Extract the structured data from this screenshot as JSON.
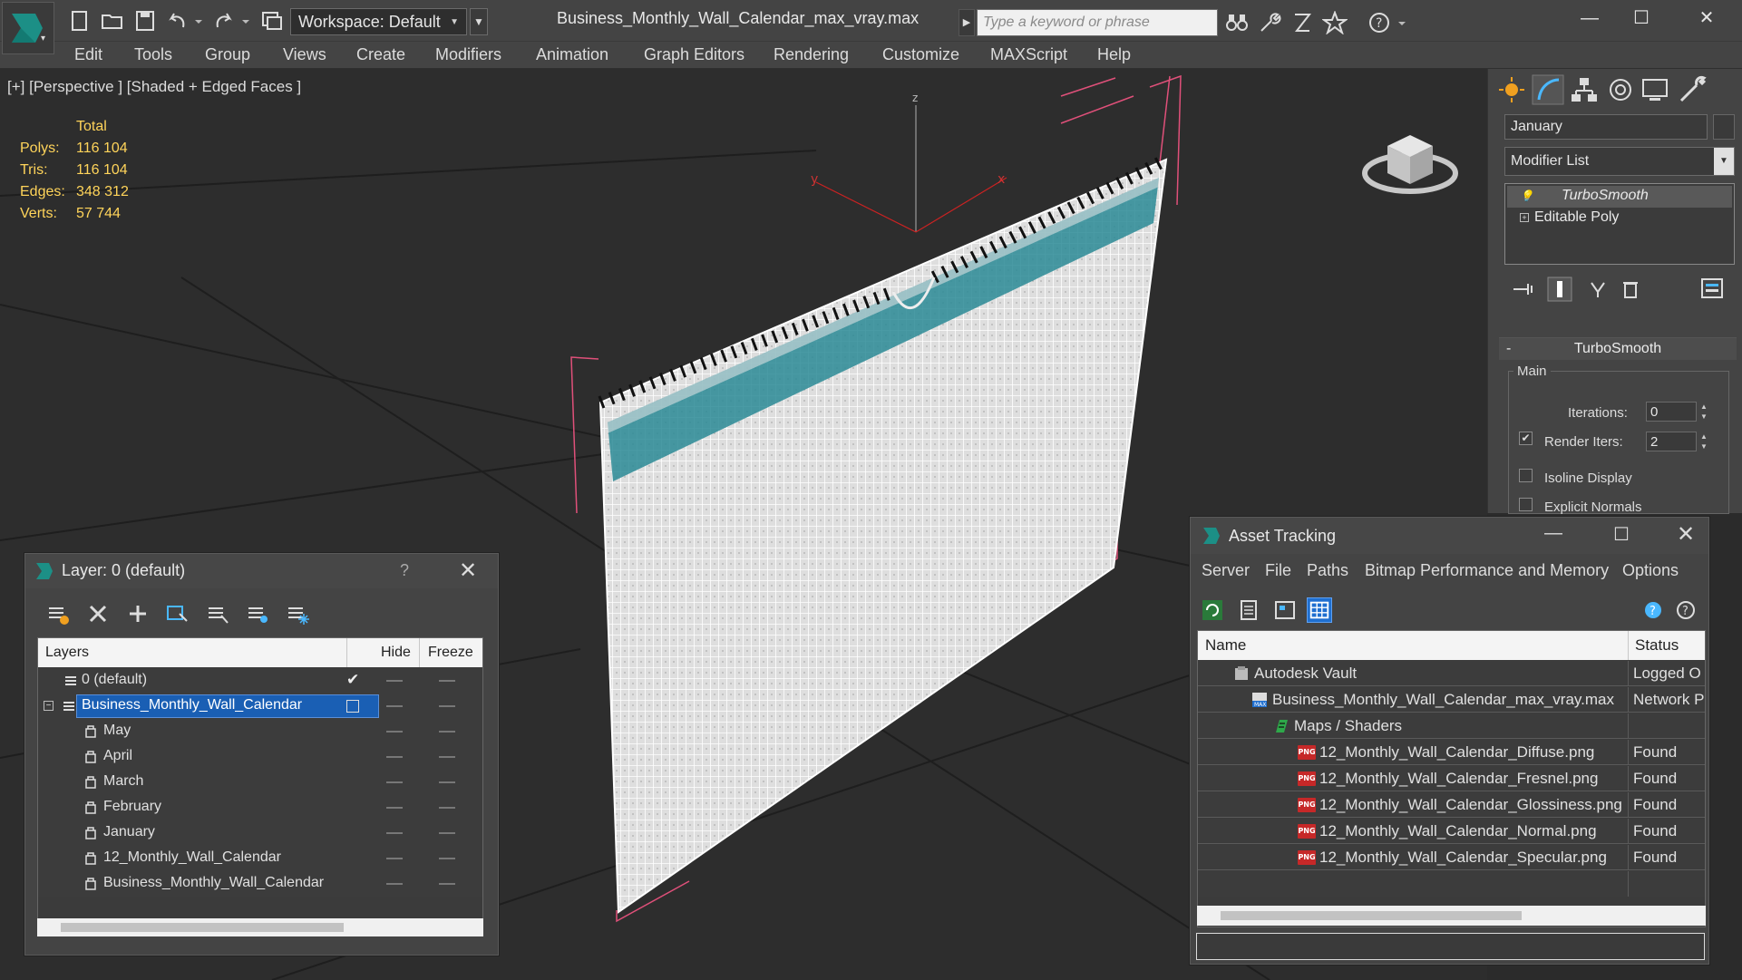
{
  "titlebar": {
    "workspace": "Workspace: Default",
    "file_title": "Business_Monthly_Wall_Calendar_max_vray.max",
    "search_placeholder": "Type a keyword or phrase",
    "minimize": "—",
    "maximize": "☐",
    "close": "✕"
  },
  "menu": [
    "Edit",
    "Tools",
    "Group",
    "Views",
    "Create",
    "Modifiers",
    "Animation",
    "Graph Editors",
    "Rendering",
    "Customize",
    "MAXScript",
    "Help"
  ],
  "viewport": {
    "label": "[+] [Perspective ] [Shaded + Edged Faces ]",
    "stats_header": "Total",
    "stats": [
      {
        "key": "Polys:",
        "value": "116 104"
      },
      {
        "key": "Tris:",
        "value": "116 104"
      },
      {
        "key": "Edges:",
        "value": "348 312"
      },
      {
        "key": "Verts:",
        "value": "57 744"
      }
    ],
    "axis_z": "z",
    "axis_y": "y",
    "axis_x": "x"
  },
  "command_panel": {
    "object_name": "January",
    "modifier_list": "Modifier List",
    "stack": [
      "TurboSmooth",
      "Editable Poly"
    ],
    "turbosmooth": {
      "title": "TurboSmooth",
      "group": "Main",
      "iterations_label": "Iterations:",
      "iterations_value": "0",
      "render_iters_label": "Render Iters:",
      "render_iters_value": "2",
      "render_iters_checked": true,
      "isoline_label": "Isoline Display",
      "isoline_checked": false,
      "explicit_normals_label": "Explicit Normals",
      "explicit_normals_checked": false
    }
  },
  "layer_dialog": {
    "title": "Layer: 0 (default)",
    "help": "?",
    "close": "✕",
    "columns": {
      "layers": "Layers",
      "hide": "Hide",
      "freeze": "Freeze"
    },
    "rows": [
      {
        "name": "0 (default)",
        "level": 0,
        "type": "layer",
        "active": true
      },
      {
        "name": "Business_Monthly_Wall_Calendar",
        "level": 0,
        "type": "layer",
        "selected": true
      },
      {
        "name": "May",
        "level": 1,
        "type": "object"
      },
      {
        "name": "April",
        "level": 1,
        "type": "object"
      },
      {
        "name": "March",
        "level": 1,
        "type": "object"
      },
      {
        "name": "February",
        "level": 1,
        "type": "object"
      },
      {
        "name": "January",
        "level": 1,
        "type": "object"
      },
      {
        "name": "12_Monthly_Wall_Calendar",
        "level": 1,
        "type": "object"
      },
      {
        "name": "Business_Monthly_Wall_Calendar",
        "level": 1,
        "type": "object"
      }
    ]
  },
  "asset_dialog": {
    "title": "Asset Tracking",
    "menu": [
      "Server",
      "File",
      "Paths",
      "Bitmap Performance and Memory",
      "Options"
    ],
    "columns": {
      "name": "Name",
      "status": "Status"
    },
    "rows": [
      {
        "name": "Autodesk Vault",
        "status": "Logged O",
        "level": 0,
        "icon": "vault"
      },
      {
        "name": "Business_Monthly_Wall_Calendar_max_vray.max",
        "status": "Network P",
        "level": 1,
        "icon": "max"
      },
      {
        "name": "Maps / Shaders",
        "status": "",
        "level": 2,
        "icon": "maps"
      },
      {
        "name": "12_Monthly_Wall_Calendar_Diffuse.png",
        "status": "Found",
        "level": 3,
        "icon": "png"
      },
      {
        "name": "12_Monthly_Wall_Calendar_Fresnel.png",
        "status": "Found",
        "level": 3,
        "icon": "png"
      },
      {
        "name": "12_Monthly_Wall_Calendar_Glossiness.png",
        "status": "Found",
        "level": 3,
        "icon": "png"
      },
      {
        "name": "12_Monthly_Wall_Calendar_Normal.png",
        "status": "Found",
        "level": 3,
        "icon": "png"
      },
      {
        "name": "12_Monthly_Wall_Calendar_Specular.png",
        "status": "Found",
        "level": 3,
        "icon": "png"
      }
    ]
  },
  "colors": {
    "ui_bg": "#444444",
    "viewport_bg": "#2d2d2d",
    "stats_yellow": "#ffd45a",
    "selection_blue": "#1a5fb4",
    "calendar_teal": "#2a8a95",
    "png_red": "#c62828"
  }
}
